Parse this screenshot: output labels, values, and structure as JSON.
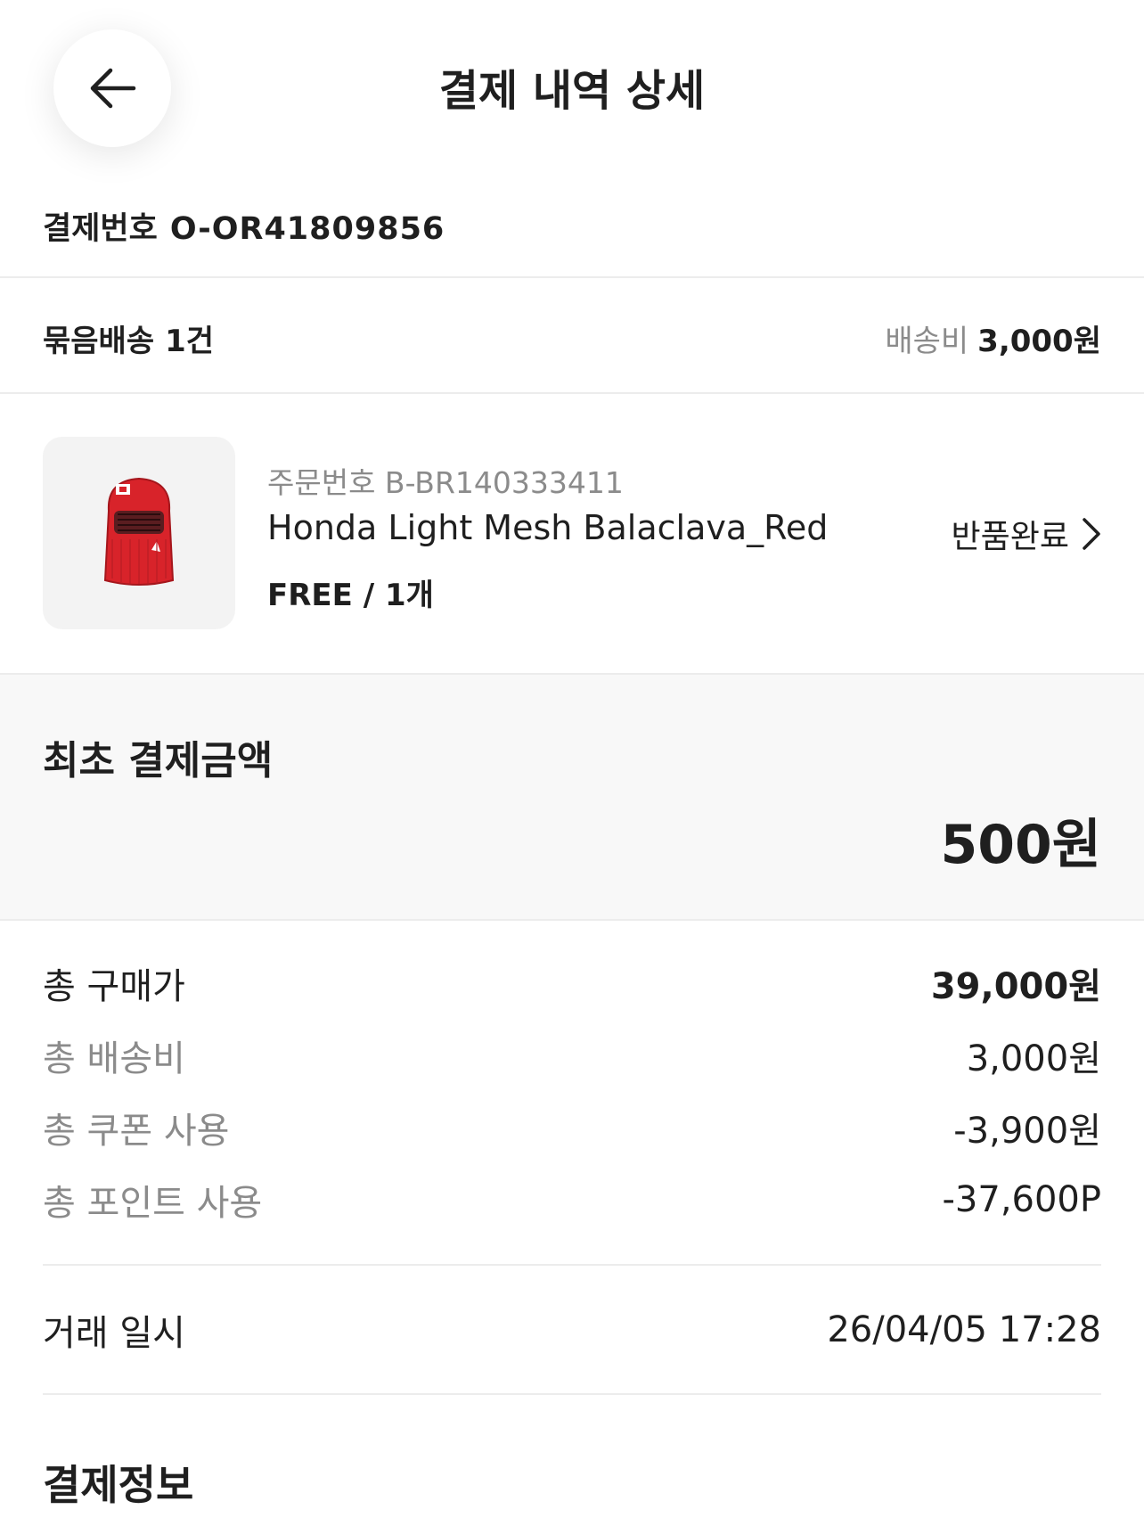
{
  "header": {
    "title": "결제 내역 상세",
    "back_icon": "arrow-left-icon"
  },
  "payment": {
    "label": "결제번호",
    "number": "O-OR41809856"
  },
  "bundle": {
    "label": "묶음배송",
    "count": "1건",
    "shipping_label": "배송비",
    "shipping_fee": "3,000원"
  },
  "product": {
    "order_no": "주문번호 B-BR140333411",
    "name": "Honda Light Mesh Balaclava_Red",
    "option": "FREE / 1개",
    "status": "반품완료",
    "image": "red-mesh-balaclava-image",
    "colors": {
      "product_red": "#d8232a"
    }
  },
  "initial_payment": {
    "label": "최초 결제금액",
    "amount": "500원"
  },
  "summary": {
    "total_price_label": "총 구매가",
    "total_price": "39,000원",
    "total_shipping_label": "총 배송비",
    "total_shipping": "3,000원",
    "total_coupon_label": "총 쿠폰 사용",
    "total_coupon": "-3,900원",
    "total_point_label": "총 포인트 사용",
    "total_point": "-37,600P"
  },
  "transaction": {
    "label": "거래 일시",
    "datetime": "26/04/05 17:28"
  },
  "payment_info": {
    "title": "결제정보"
  }
}
